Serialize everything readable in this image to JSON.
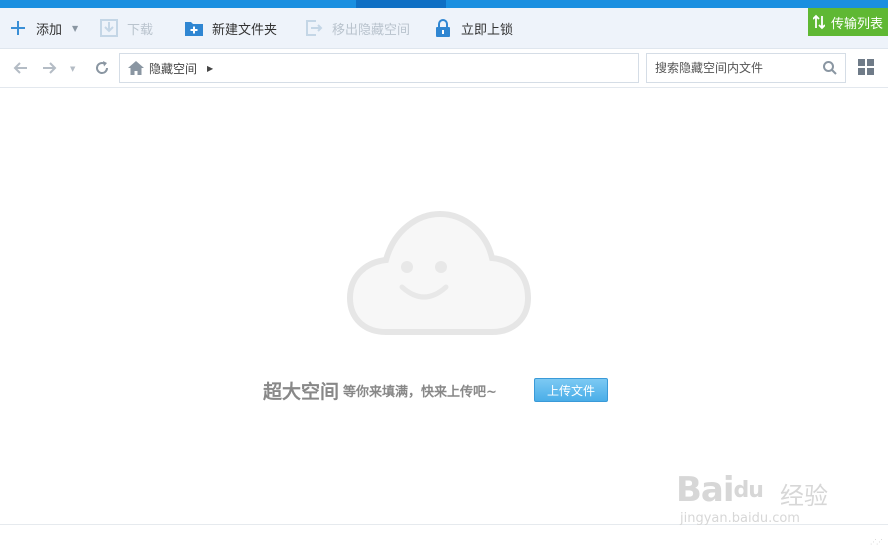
{
  "toolbar": {
    "add_label": "添加",
    "download_label": "下载",
    "new_folder_label": "新建文件夹",
    "move_out_label": "移出隐藏空间",
    "lock_label": "立即上锁",
    "transfer_list_label": "传输列表"
  },
  "navbar": {
    "breadcrumb_root": "隐藏空间",
    "search_placeholder": "搜索隐藏空间内文件"
  },
  "empty_state": {
    "headline": "超大空间",
    "subline": "等你来填满，快来上传吧~",
    "upload_button": "上传文件"
  },
  "watermark": {
    "brand": "Bai",
    "brand_paw": "du",
    "suffix": "经验",
    "url": "jingyan.baidu.com"
  },
  "colors": {
    "accent_blue": "#1a8fe0",
    "transfer_green": "#5fb833",
    "upload_blue": "#4aaee8",
    "toolbar_bg": "#eef3fa"
  }
}
